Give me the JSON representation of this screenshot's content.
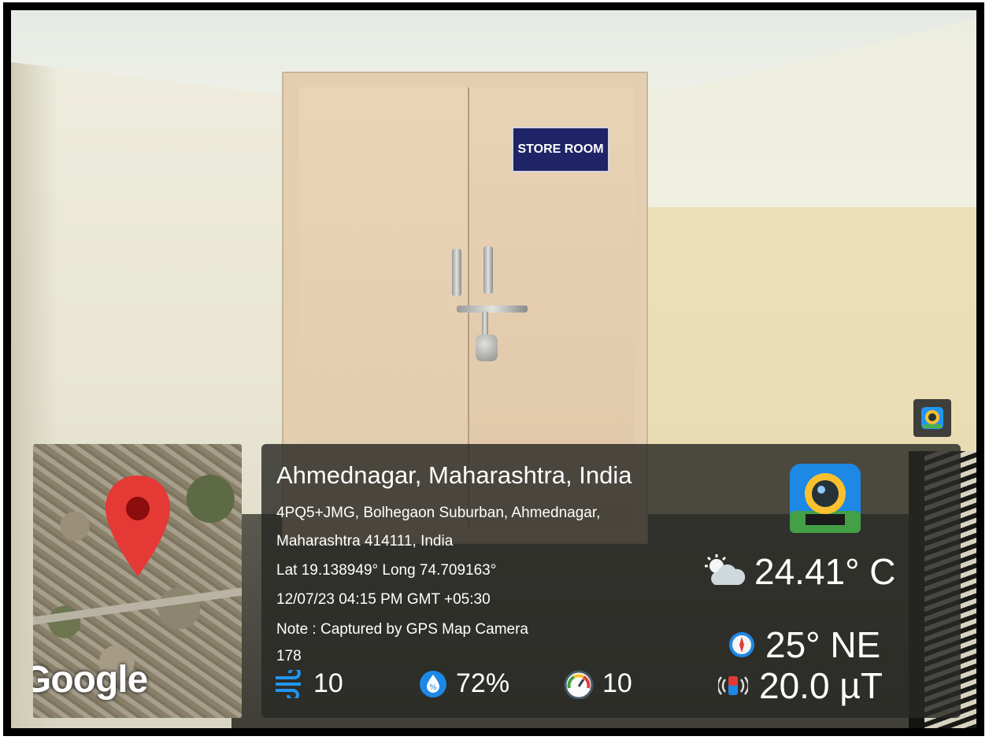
{
  "sign": {
    "text": "STORE ROOM"
  },
  "map": {
    "brand": "Google",
    "pin_icon": "location-pin-icon"
  },
  "overlay": {
    "title": "Ahmednagar, Maharashtra, India",
    "address_line1": "4PQ5+JMG, Bolhegaon Suburban, Ahmednagar,",
    "address_line2": "Maharashtra 414111, India",
    "lat_long": "Lat 19.138949° Long 74.709163°",
    "datetime": "12/07/23 04:15 PM GMT +05:30",
    "note": "Note : Captured by GPS Map Camera",
    "altitude": "178",
    "wind": "10",
    "humidity": "72%",
    "pressure": "10",
    "temperature": "24.41° C",
    "compass": "25° NE",
    "magnetic": "20.0 µT"
  },
  "colors": {
    "sign_blue": "#1f2466",
    "pin_red": "#e53935",
    "icon_blue": "#1e88e5",
    "card_bg": "rgba(40,40,36,0.82)"
  }
}
